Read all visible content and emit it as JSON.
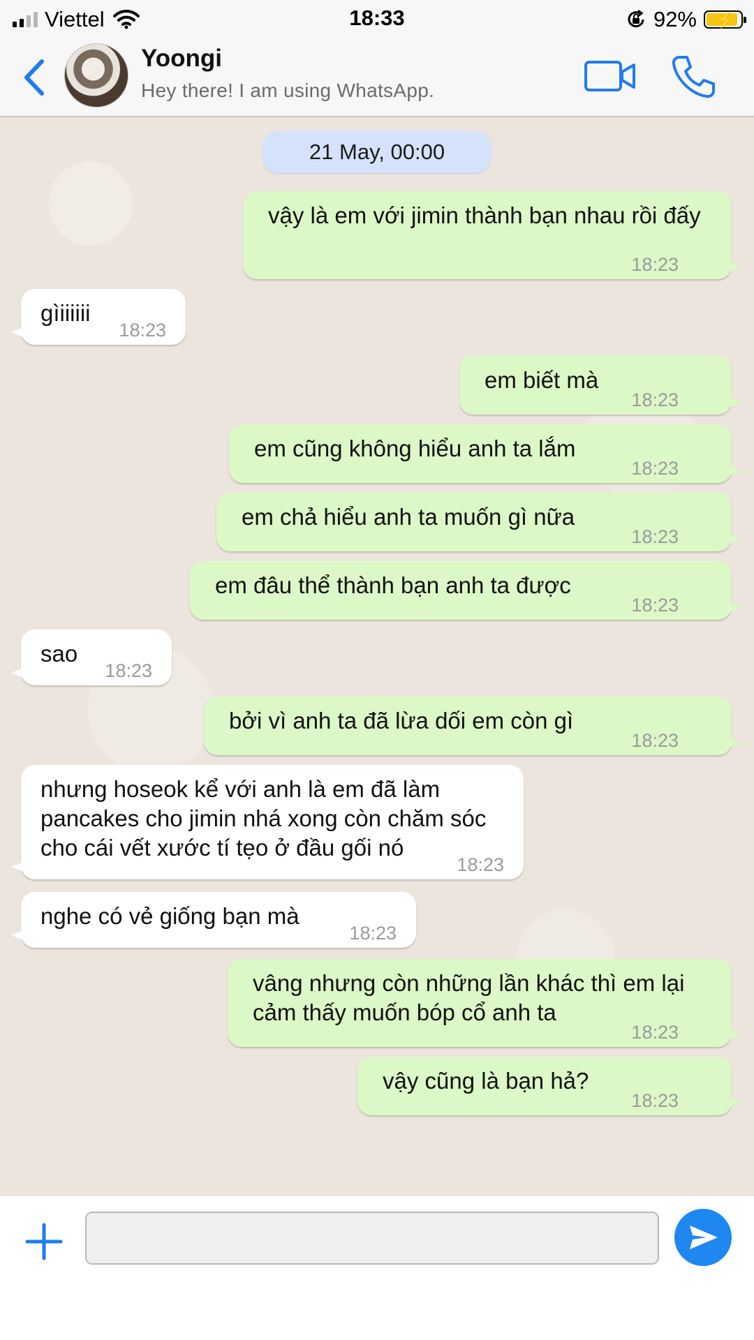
{
  "status_bar": {
    "carrier": "Viettel",
    "time": "18:33",
    "battery": "92%",
    "battery_level": 0.92,
    "icons": [
      "signal-icon",
      "wifi-icon",
      "orientation-lock-icon",
      "battery-charging-icon"
    ]
  },
  "header": {
    "name": "Yoongi",
    "status": "Hey there! I am using WhatsApp.",
    "icons": [
      "back-icon",
      "video-call-icon",
      "phone-call-icon"
    ]
  },
  "chat": {
    "date": "21 May, 00:00",
    "messages": [
      {
        "dir": "out",
        "text": "vậy là em với jimin thành bạn nhau rồi đấy",
        "time": "18:23"
      },
      {
        "dir": "in",
        "text": "gìiiiiii",
        "time": "18:23"
      },
      {
        "dir": "out",
        "text": "em biết mà",
        "time": "18:23"
      },
      {
        "dir": "out",
        "text": "em cũng không hiểu anh ta lắm",
        "time": "18:23"
      },
      {
        "dir": "out",
        "text": "em chả hiểu anh ta muốn gì nữa",
        "time": "18:23"
      },
      {
        "dir": "out",
        "text": "em đâu thể thành bạn anh ta được",
        "time": "18:23"
      },
      {
        "dir": "in",
        "text": "sao",
        "time": "18:23"
      },
      {
        "dir": "out",
        "text": "bởi vì anh ta đã lừa dối em còn gì",
        "time": "18:23"
      },
      {
        "dir": "in",
        "text": "nhưng hoseok kể với anh là em đã làm pancakes cho jimin nhá xong còn chăm sóc cho cái vết xước tí tẹo ở đầu gối nó",
        "time": "18:23"
      },
      {
        "dir": "in",
        "text": "nghe có vẻ giống bạn mà",
        "time": "18:23"
      },
      {
        "dir": "out",
        "text": "vâng nhưng còn những lần khác thì em lại cảm thấy muốn bóp cổ anh ta",
        "time": "18:23"
      },
      {
        "dir": "out",
        "text": "vậy cũng là bạn hả?",
        "time": "18:23"
      }
    ]
  },
  "input": {
    "value": "",
    "placeholder": "",
    "icons": [
      "plus-icon",
      "send-icon"
    ]
  },
  "colors": {
    "outgoing_bubble": "#dcf8c6",
    "incoming_bubble": "#ffffff",
    "date_pill": "#d4e2fb",
    "accent": "#1e88f0",
    "chat_background": "#ece5dd"
  }
}
